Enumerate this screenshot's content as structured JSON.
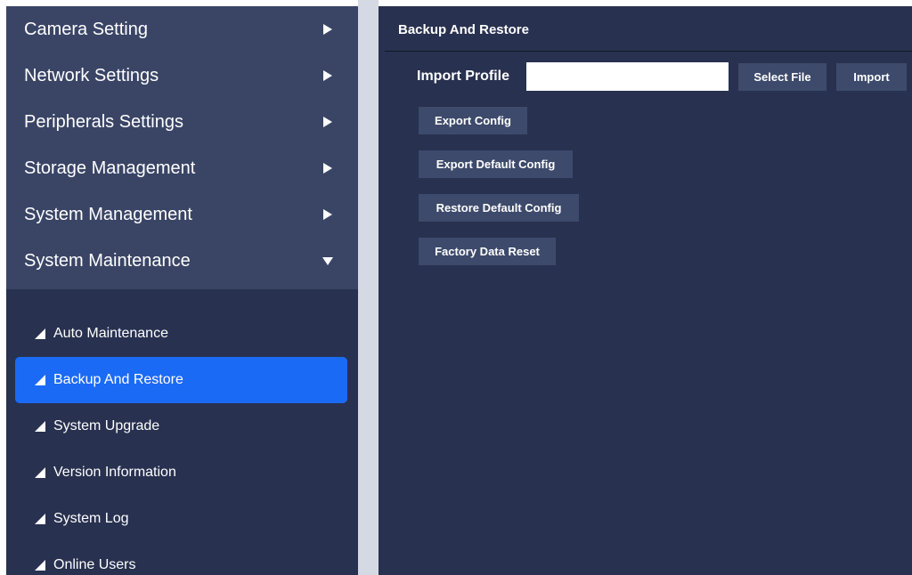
{
  "sidebar": {
    "menu": [
      {
        "label": "Camera Setting",
        "expanded": false
      },
      {
        "label": "Network Settings",
        "expanded": false
      },
      {
        "label": "Peripherals Settings",
        "expanded": false
      },
      {
        "label": "Storage Management",
        "expanded": false
      },
      {
        "label": "System Management",
        "expanded": false
      },
      {
        "label": "System Maintenance",
        "expanded": true
      }
    ],
    "submenu": [
      {
        "label": "Auto Maintenance",
        "active": false
      },
      {
        "label": "Backup And Restore",
        "active": true
      },
      {
        "label": "System Upgrade",
        "active": false
      },
      {
        "label": "Version Information",
        "active": false
      },
      {
        "label": "System Log",
        "active": false
      },
      {
        "label": "Online Users",
        "active": false
      }
    ]
  },
  "main": {
    "title": "Backup And Restore",
    "import_label": "Import Profile",
    "import_value": "",
    "select_file_label": "Select File",
    "import_button_label": "Import",
    "export_config_label": "Export Config",
    "export_default_label": "Export Default Config",
    "restore_default_label": "Restore Default Config",
    "factory_reset_label": "Factory Data Reset"
  },
  "colors": {
    "panel": "#28314f",
    "menu_header": "#3a4566",
    "active": "#1b6af5",
    "button": "#3d4a6b"
  }
}
